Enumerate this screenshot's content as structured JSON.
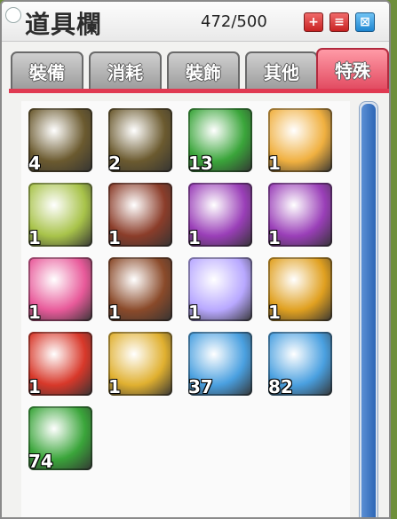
{
  "window": {
    "title": "道具欄",
    "count": "472/500",
    "buttons": [
      "plus-icon",
      "list-icon",
      "grid-icon"
    ]
  },
  "tabs": [
    {
      "label": "裝備",
      "active": false
    },
    {
      "label": "消耗",
      "active": false
    },
    {
      "label": "裝飾",
      "active": false
    },
    {
      "label": "其他",
      "active": false
    },
    {
      "label": "特殊",
      "active": true
    }
  ],
  "items": [
    {
      "name": "scroll-refresh-icon",
      "qty": "4",
      "color": "#6b5a2f"
    },
    {
      "name": "scroll-refresh-icon",
      "qty": "2",
      "color": "#6b5a2f"
    },
    {
      "name": "green-potion-icon",
      "qty": "13",
      "color": "#3aa53a"
    },
    {
      "name": "panda-icon",
      "qty": "1",
      "color": "#f0b040"
    },
    {
      "name": "wolf-mount-icon",
      "qty": "1",
      "color": "#a8c34a"
    },
    {
      "name": "armor-mount-icon",
      "qty": "1",
      "color": "#8b3d2a"
    },
    {
      "name": "purple-dress-icon",
      "qty": "1",
      "color": "#9a3fb8"
    },
    {
      "name": "purple-dress-icon",
      "qty": "1",
      "color": "#9a3fb8"
    },
    {
      "name": "pink-scooter-icon",
      "qty": "1",
      "color": "#e85a9a"
    },
    {
      "name": "reindeer-icon",
      "qty": "1",
      "color": "#8a4a2a"
    },
    {
      "name": "butterfly-wings-icon",
      "qty": "1",
      "color": "#b8a8ff"
    },
    {
      "name": "medal-icon",
      "qty": "1",
      "color": "#e0a020"
    },
    {
      "name": "megaphone-icon",
      "qty": "1",
      "color": "#d8382a"
    },
    {
      "name": "gift-box-icon",
      "qty": "1",
      "color": "#e0b030"
    },
    {
      "name": "shield-token-icon",
      "qty": "37",
      "color": "#4aa0e0"
    },
    {
      "name": "shield-token-icon",
      "qty": "82",
      "color": "#4aa0e0"
    },
    {
      "name": "green-potion-icon",
      "qty": "74",
      "color": "#3aa53a"
    }
  ]
}
